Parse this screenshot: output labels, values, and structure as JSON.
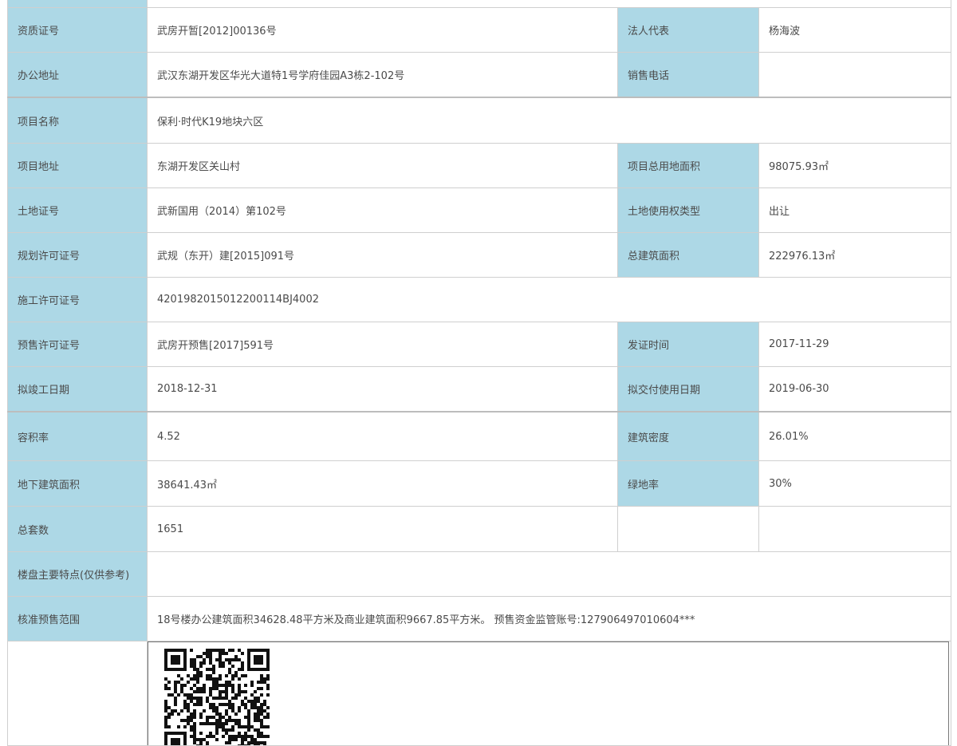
{
  "rows": {
    "qualification_no": {
      "label": "资质证号",
      "value": "武房开暂[2012]00136号"
    },
    "legal_rep": {
      "label": "法人代表",
      "value": "杨海波"
    },
    "office_address": {
      "label": "办公地址",
      "value": "武汉东湖开发区华光大道特1号学府佳园A3栋2-102号"
    },
    "sales_phone": {
      "label": "销售电话",
      "value": ""
    },
    "project_name": {
      "label": "项目名称",
      "value": "保利·时代K19地块六区"
    },
    "project_address": {
      "label": "项目地址",
      "value": "东湖开发区关山村"
    },
    "total_land_area": {
      "label": "项目总用地面积",
      "value": "98075.93㎡"
    },
    "land_cert_no": {
      "label": "土地证号",
      "value": "武新国用（2014）第102号"
    },
    "land_use_type": {
      "label": "土地使用权类型",
      "value": "出让"
    },
    "planning_permit_no": {
      "label": "规划许可证号",
      "value": "武规（东开）建[2015]091号"
    },
    "total_building_area": {
      "label": "总建筑面积",
      "value": "222976.13㎡"
    },
    "construction_permit_no": {
      "label": "施工许可证号",
      "value": "4201982015012200114BJ4002"
    },
    "presale_permit_no": {
      "label": "预售许可证号",
      "value": "武房开预售[2017]591号"
    },
    "issue_date": {
      "label": "发证时间",
      "value": "2017-11-29"
    },
    "planned_completion_date": {
      "label": "拟竣工日期",
      "value": "2018-12-31"
    },
    "planned_delivery_date": {
      "label": "拟交付使用日期",
      "value": "2019-06-30"
    },
    "plot_ratio": {
      "label": "容积率",
      "value": "4.52"
    },
    "building_density": {
      "label": "建筑密度",
      "value": "26.01%"
    },
    "underground_area": {
      "label": "地下建筑面积",
      "value": "38641.43㎡"
    },
    "green_ratio": {
      "label": "绿地率",
      "value": "30%"
    },
    "total_units": {
      "label": "总套数",
      "value": "1651"
    },
    "main_features": {
      "label": "楼盘主要特点(仅供参考)",
      "value": ""
    },
    "approved_presale_scope": {
      "label": "核准预售范围",
      "value": "18号楼办公建筑面积34628.48平方米及商业建筑面积9667.85平方米。 预售资金监管账号:127906497010604***"
    }
  },
  "colors": {
    "label_bg": "#add8e6",
    "value_bg": "#ffffff",
    "border": "#cfcfcf",
    "text": "#4a4a4a"
  },
  "icons": {
    "qr": "qr-code-icon"
  }
}
